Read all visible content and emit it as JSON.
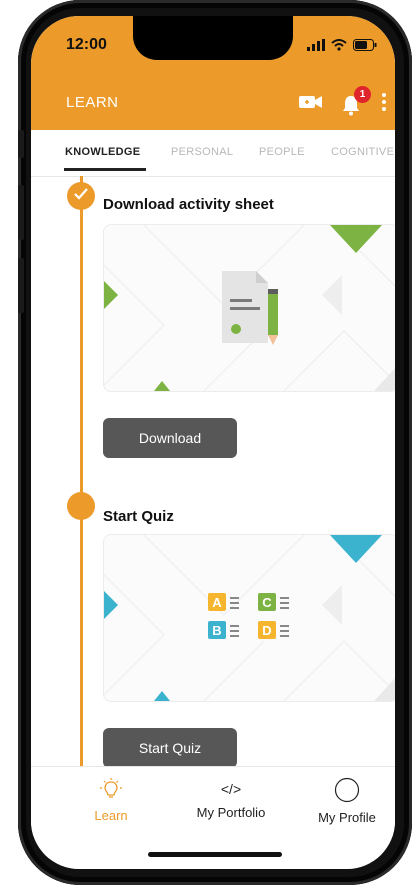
{
  "status": {
    "time": "12:00"
  },
  "app_bar": {
    "title": "LEARN",
    "notification_count": "1"
  },
  "tabs": [
    {
      "label": "KNOWLEDGE"
    },
    {
      "label": "PERSONAL"
    },
    {
      "label": "PEOPLE"
    },
    {
      "label": "COGNITIVE"
    }
  ],
  "timeline": [
    {
      "title": "Download activity sheet",
      "button": "Download"
    },
    {
      "title": "Start Quiz",
      "button": "Start Quiz",
      "quiz_options": [
        "A",
        "C",
        "B",
        "D"
      ]
    }
  ],
  "bottom_nav": [
    {
      "label": "Learn"
    },
    {
      "label": "My Portfolio",
      "icon_text": "</>"
    },
    {
      "label": "My Profile"
    }
  ],
  "colors": {
    "brand": "#EC9B2B",
    "button": "#575757",
    "badge": "#E0242C",
    "accent_green": "#7CB342",
    "accent_blue": "#3BB3CF"
  }
}
